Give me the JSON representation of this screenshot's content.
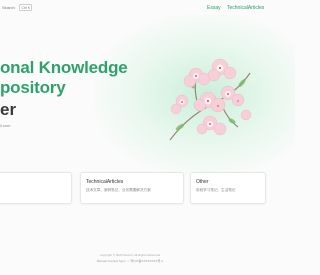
{
  "header": {
    "search_label": "Search",
    "shortcut": "Ctrl K",
    "nav": [
      "Essay",
      "TechnicalArticles"
    ]
  },
  "hero": {
    "title_line1": "onal Knowledge",
    "title_line2": "pository",
    "subtitle": "er",
    "email": "il.com"
  },
  "cards": [
    {
      "title": "",
      "desc": ""
    },
    {
      "title": "TechnicalArticles",
      "desc": "技术文章、案例笔记、业务需要解决方案"
    },
    {
      "title": "Other",
      "desc": "前段学习笔记、生活笔记"
    }
  ],
  "footer": {
    "copyright": "copyright © 2023 Sociol | All Rights Reserved",
    "link1": "Manual Content Sync",
    "link2": "粤ICP备XXXXXXXX号-1"
  },
  "colors": {
    "accent": "#2fa26c",
    "background": "#fafbfa"
  }
}
